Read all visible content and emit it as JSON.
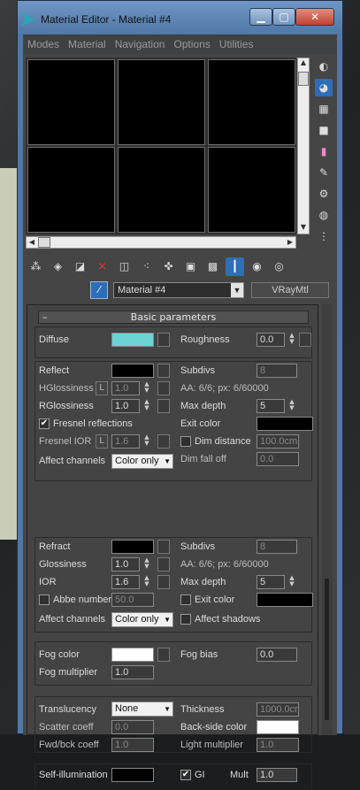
{
  "window": {
    "title": "Material Editor - Material #4",
    "minimize": "▁",
    "maximize": "▢",
    "close": "✕"
  },
  "menu": [
    "Modes",
    "Material",
    "Navigation",
    "Options",
    "Utilities"
  ],
  "sample_slots": {
    "count": 6
  },
  "side_tools": [
    "sample-type-icon",
    "backlight-icon",
    "background-icon",
    "tiling-icon",
    "video-color-check-icon",
    "make-preview-icon",
    "options-icon",
    "select-by-material-icon",
    "navigator-icon"
  ],
  "toolbar": [
    "get-material-icon",
    "put-to-scene-icon",
    "assign-material-icon",
    "reset-icon",
    "copy-material-icon",
    "make-unique-icon",
    "put-to-library-icon",
    "material-id-icon",
    "show-in-viewport-icon",
    "show-end-result-icon",
    "go-to-parent-icon",
    "go-forward-icon"
  ],
  "material": {
    "name": "Material #4",
    "type": "VRayMtl"
  },
  "rollout": {
    "title": "Basic parameters",
    "collapse": "–"
  },
  "diffuse": {
    "label": "Diffuse",
    "color": "#6cd4d4",
    "roughness_label": "Roughness",
    "roughness": "0.0"
  },
  "reflect": {
    "label": "Reflect",
    "color": "#000000",
    "hglossiness_label": "HGlossiness",
    "hglossiness": "1.0",
    "l": "L",
    "rglossiness_label": "RGlossiness",
    "rglossiness": "1.0",
    "fresnel_label": "Fresnel reflections",
    "fresnel_checked": "✔",
    "fresnel_ior_label": "Fresnel IOR",
    "fresnel_ior": "1.6",
    "affect_label": "Affect channels",
    "affect_value": "Color only",
    "subdivs_label": "Subdivs",
    "subdivs": "8",
    "aa_text": "AA: 6/6; px: 6/60000",
    "max_depth_label": "Max depth",
    "max_depth": "5",
    "exit_color_label": "Exit color",
    "dim_distance_label": "Dim distance",
    "dim_distance": "100.0cm",
    "dim_falloff_label": "Dim fall off",
    "dim_falloff": "0.0"
  },
  "refract": {
    "label": "Refract",
    "color": "#000000",
    "glossiness_label": "Glossiness",
    "glossiness": "1.0",
    "ior_label": "IOR",
    "ior": "1.6",
    "abbe_label": "Abbe number",
    "abbe": "50.0",
    "affect_label": "Affect channels",
    "affect_value": "Color only",
    "subdivs_label": "Subdivs",
    "subdivs": "8",
    "aa_text": "AA: 6/6; px: 6/60000",
    "max_depth_label": "Max depth",
    "max_depth": "5",
    "exit_color_label": "Exit color",
    "affect_shadows_label": "Affect shadows"
  },
  "fog": {
    "color_label": "Fog color",
    "multiplier_label": "Fog multiplier",
    "multiplier": "1.0",
    "bias_label": "Fog bias",
    "bias": "0.0"
  },
  "translucency": {
    "label": "Translucency",
    "value": "None",
    "scatter_label": "Scatter coeff",
    "scatter": "0.0",
    "fwd_label": "Fwd/bck coeff",
    "fwd": "1.0",
    "thickness_label": "Thickness",
    "thickness": "1000.0cm",
    "backside_label": "Back-side color",
    "light_mult_label": "Light multiplier",
    "light_mult": "1.0"
  },
  "selfillum": {
    "label": "Self-illumination",
    "gi_label": "GI",
    "gi_checked": "✔",
    "mult_label": "Mult",
    "mult": "1.0"
  }
}
